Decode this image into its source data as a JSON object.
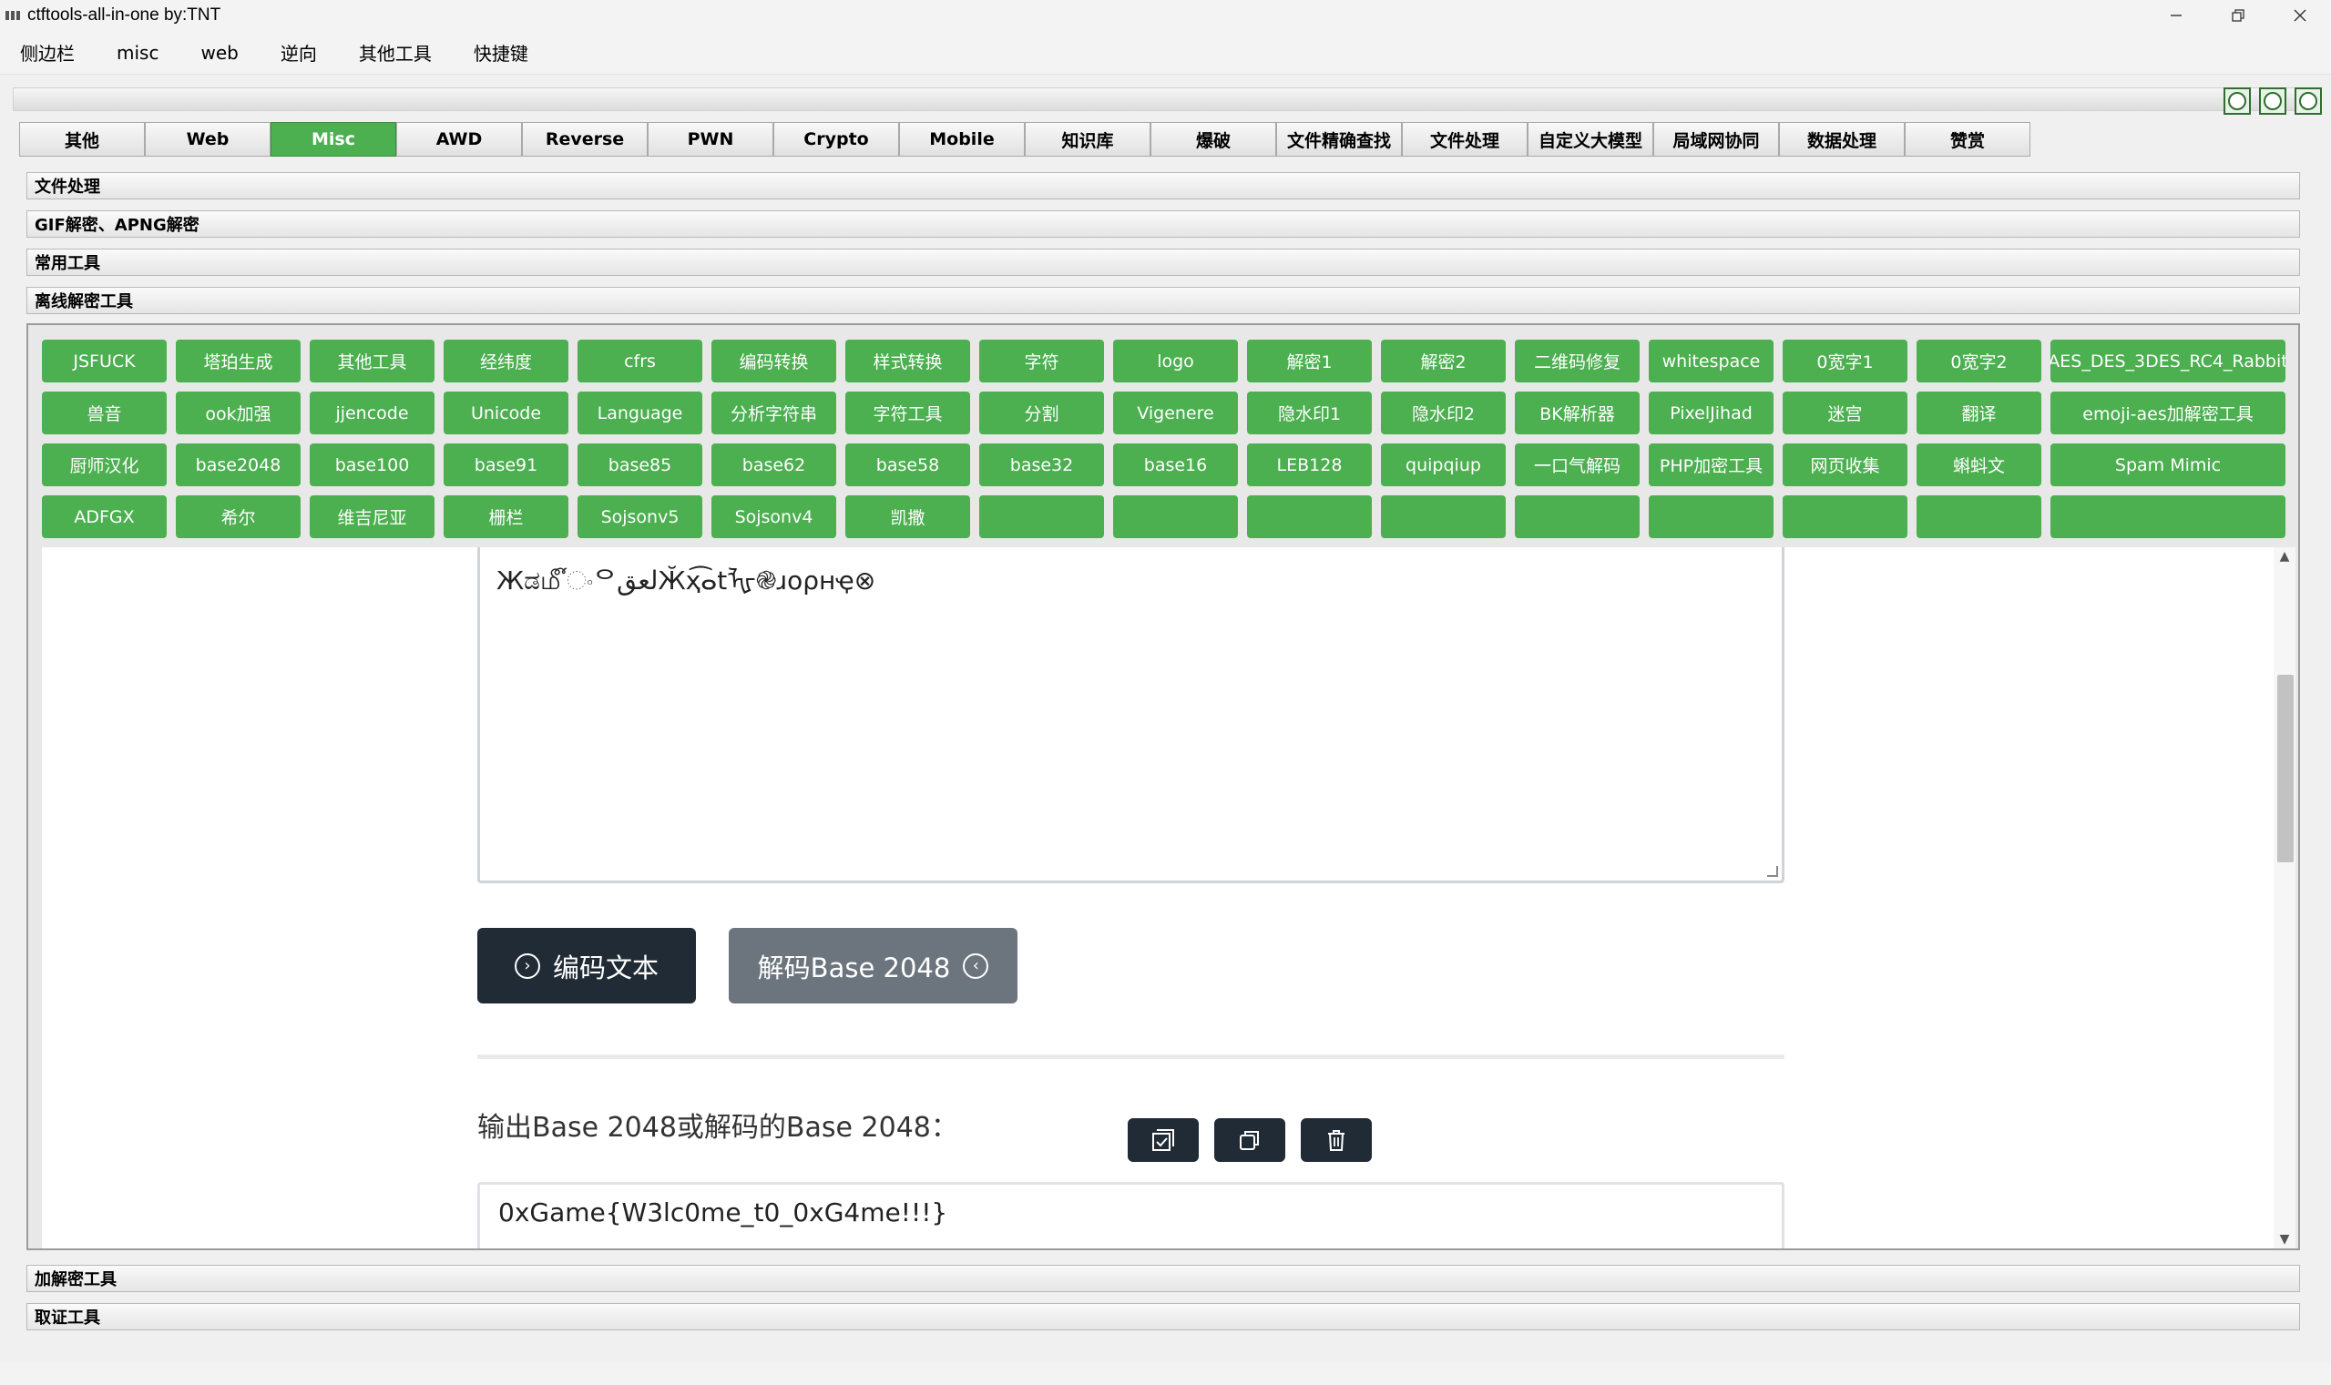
{
  "window": {
    "title": "ctftools-all-in-one   by:TNT"
  },
  "menu": [
    "侧边栏",
    "misc",
    "web",
    "逆向",
    "其他工具",
    "快捷键"
  ],
  "tabs": [
    "其他",
    "Web",
    "Misc",
    "AWD",
    "Reverse",
    "PWN",
    "Crypto",
    "Mobile",
    "知识库",
    "爆破",
    "文件精确查找",
    "文件处理",
    "自定义大模型",
    "局域网协同",
    "数据处理",
    "赞赏"
  ],
  "active_tab": "Misc",
  "sections_top": [
    "文件处理",
    "GIF解密、APNG解密",
    "常用工具",
    "离线解密工具"
  ],
  "sections_bottom": [
    "加解密工具",
    "取证工具"
  ],
  "tool_rows": [
    [
      "JSFUCK",
      "塔珀生成",
      "其他工具",
      "经纬度",
      "cfrs",
      "编码转换",
      "样式转换",
      "字符",
      "logo",
      "解密1",
      "解密2",
      "二维码修复",
      "whitespace",
      "0宽字1",
      "0宽字2",
      "AES_DES_3DES_RC4_Rabbit"
    ],
    [
      "兽音",
      "ook加强",
      "jjencode",
      "Unicode",
      "Language",
      "分析字符串",
      "字符工具",
      "分割",
      "Vigenere",
      "隐水印1",
      "隐水印2",
      "BK解析器",
      "PixelJihad",
      "迷宫",
      "翻译",
      "emoji-aes加解密工具"
    ],
    [
      "厨师汉化",
      "base2048",
      "base100",
      "base91",
      "base85",
      "base62",
      "base58",
      "base32",
      "base16",
      "LEB128",
      "quipqiup",
      "一口气解码",
      "PHP加密工具",
      "网页收集",
      "蝌蚪文",
      "Spam Mimic"
    ],
    [
      "ADFGX",
      "希尔",
      "维吉尼亚",
      "栅栏",
      "Sojsonv5",
      "Sojsonv4",
      "凯撒",
      "",
      "",
      "",
      "",
      "",
      "",
      "",
      "",
      ""
    ]
  ],
  "web": {
    "input_text": "Жಡ௴ංᄋلعقӁҳ͡ⴰtᡀ֎ɹօρʜҿ⊗",
    "encode_label": "编码文本",
    "decode_label": "解码Base 2048",
    "output_label": "输出Base 2048或解码的Base 2048：",
    "output_text": "0xGame{W3lc0me_t0_0xG4me!!!}"
  },
  "colors": {
    "accent_green": "#4caf50",
    "dark_button": "#212b36",
    "gray_button": "#6c757d"
  }
}
